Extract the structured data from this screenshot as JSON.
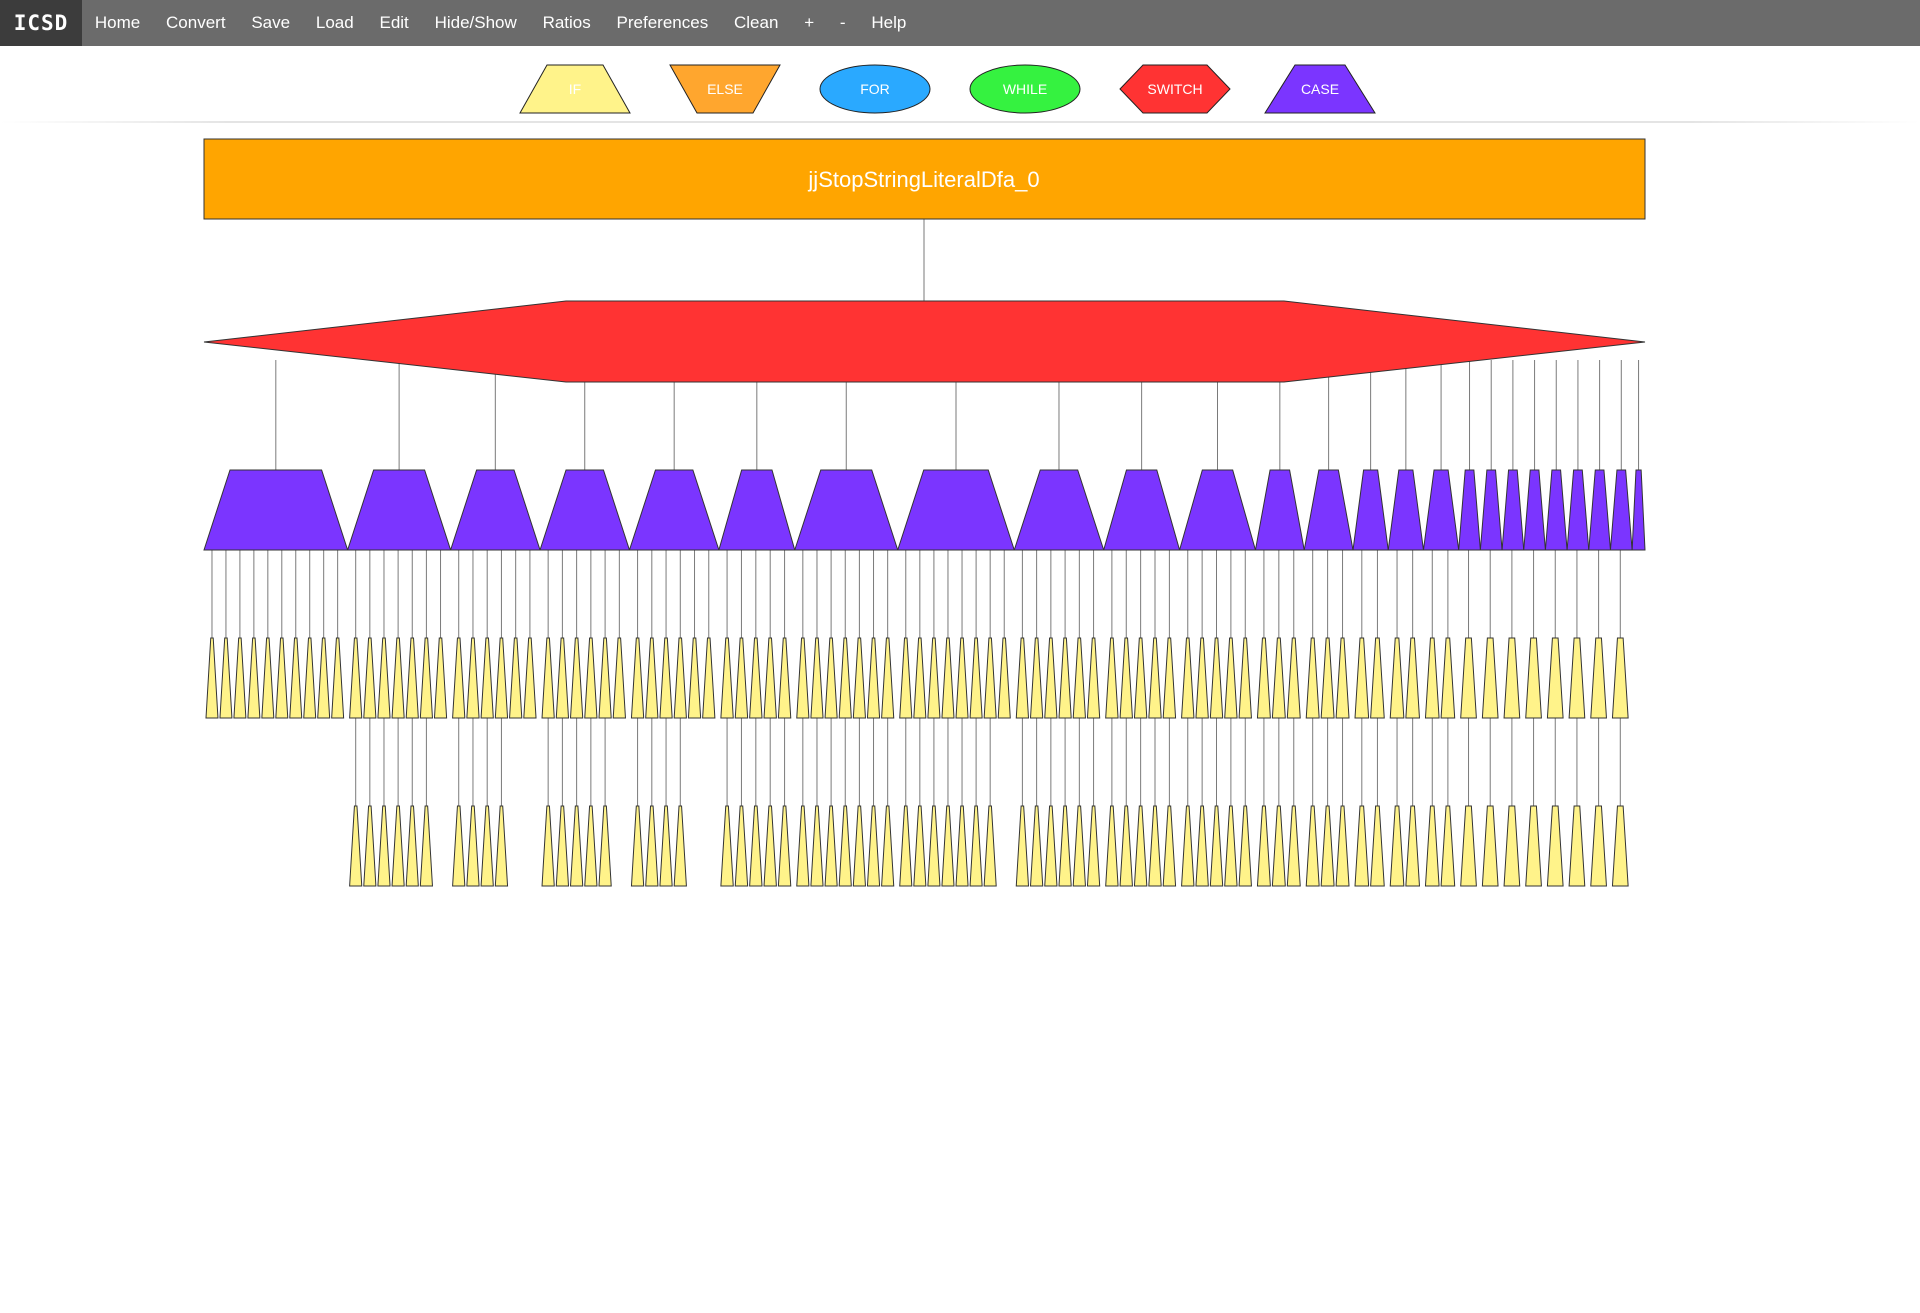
{
  "app": {
    "brand": "ICSD",
    "menu": [
      "Home",
      "Convert",
      "Save",
      "Load",
      "Edit",
      "Hide/Show",
      "Ratios",
      "Preferences",
      "Clean",
      "+",
      "-",
      "Help"
    ]
  },
  "legend": [
    {
      "label": "IF",
      "shape": "trapezoid",
      "color": "#fff38a"
    },
    {
      "label": "ELSE",
      "shape": "inverted-trapezoid",
      "color": "#ffa62e"
    },
    {
      "label": "FOR",
      "shape": "ellipse",
      "color": "#2aa9ff"
    },
    {
      "label": "WHILE",
      "shape": "ellipse",
      "color": "#35f240"
    },
    {
      "label": "SWITCH",
      "shape": "hexagon",
      "color": "#ff3333"
    },
    {
      "label": "CASE",
      "shape": "trapezoid",
      "color": "#7b35ff"
    }
  ],
  "colors": {
    "function": "#ffa500",
    "switch": "#ff3333",
    "case": "#7b35ff",
    "if": "#fff38a",
    "edge": "#7a7a7a"
  },
  "diagram": {
    "function_name": "jjStopStringLiteralDfa_0",
    "switch_count": 1,
    "case_count": 25,
    "if_groups": [
      {
        "case": 1,
        "ifs": 10,
        "nested": 0
      },
      {
        "case": 2,
        "ifs": 7,
        "nested": 6
      },
      {
        "case": 3,
        "ifs": 6,
        "nested": 4
      },
      {
        "case": 4,
        "ifs": 6,
        "nested": 5
      },
      {
        "case": 5,
        "ifs": 6,
        "nested": 4
      },
      {
        "case": 6,
        "ifs": 5,
        "nested": 5
      },
      {
        "case": 7,
        "ifs": 7,
        "nested": 7
      },
      {
        "case": 8,
        "ifs": 8,
        "nested": 7
      },
      {
        "case": 9,
        "ifs": 6,
        "nested": 6
      },
      {
        "case": 10,
        "ifs": 5,
        "nested": 5
      },
      {
        "case": 11,
        "ifs": 5,
        "nested": 5
      },
      {
        "case": 12,
        "ifs": 3,
        "nested": 3
      },
      {
        "case": 13,
        "ifs": 3,
        "nested": 3
      },
      {
        "case": 14,
        "ifs": 2,
        "nested": 2
      },
      {
        "case": 15,
        "ifs": 2,
        "nested": 2
      },
      {
        "case": 16,
        "ifs": 2,
        "nested": 2
      },
      {
        "case": 17,
        "ifs": 1,
        "nested": 1
      },
      {
        "case": 18,
        "ifs": 1,
        "nested": 1
      },
      {
        "case": 19,
        "ifs": 1,
        "nested": 1
      },
      {
        "case": 20,
        "ifs": 1,
        "nested": 1
      },
      {
        "case": 21,
        "ifs": 1,
        "nested": 1
      },
      {
        "case": 22,
        "ifs": 1,
        "nested": 1
      },
      {
        "case": 23,
        "ifs": 1,
        "nested": 1
      },
      {
        "case": 24,
        "ifs": 1,
        "nested": 1
      },
      {
        "case": 25,
        "ifs": 0,
        "nested": 0
      }
    ]
  }
}
